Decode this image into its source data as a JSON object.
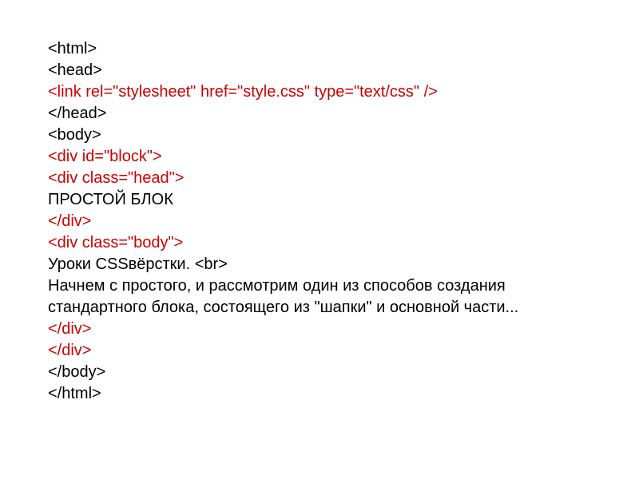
{
  "lines": [
    {
      "text": "<html>",
      "color": "black"
    },
    {
      "text": "<head>",
      "color": "black"
    },
    {
      "text": "<link rel=\"stylesheet\" href=\"style.css\" type=\"text/css\" />",
      "color": "red"
    },
    {
      "text": "</head>",
      "color": "black"
    },
    {
      "text": "<body>",
      "color": "black"
    },
    {
      "text": "<div id=\"block\">",
      "color": "red"
    },
    {
      "text": "<div class=\"head\">",
      "color": "red"
    },
    {
      "text": "ПРОСТОЙ БЛОК",
      "color": "black"
    },
    {
      "text": "</div>",
      "color": "red"
    },
    {
      "text": "<div class=\"body\">",
      "color": "red"
    },
    {
      "text": "Уроки CSSвёрстки. <br>",
      "color": "black"
    },
    {
      "text": "Начнем с простого, и рассмотрим один из способов создания стандартного блока, состоящего из \"шапки\" и основной части...",
      "color": "black"
    },
    {
      "text": "</div>",
      "color": "red"
    },
    {
      "text": "</div>",
      "color": "red"
    },
    {
      "text": "</body>",
      "color": "black"
    },
    {
      "text": "</html>",
      "color": "black"
    }
  ]
}
